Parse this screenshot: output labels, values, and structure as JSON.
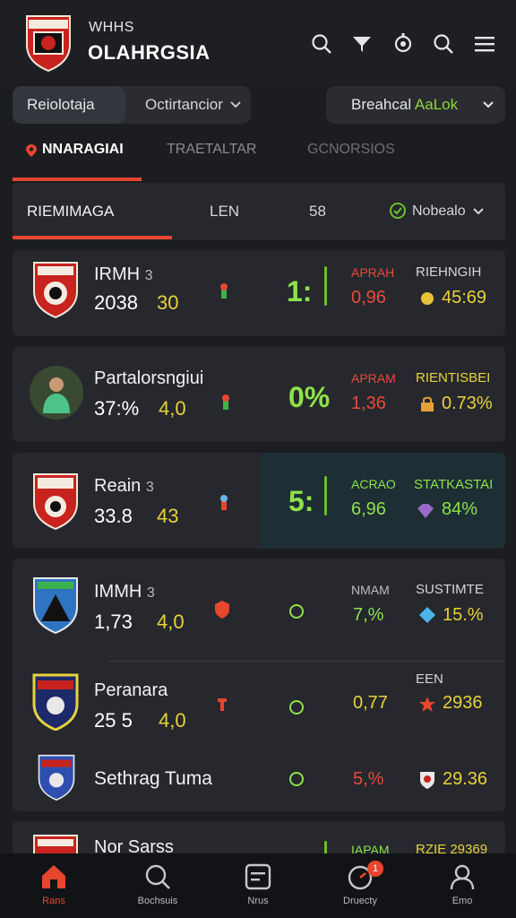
{
  "header": {
    "brand_top": "WHHS",
    "brand_main": "OLAHRGSIA",
    "icons": [
      "search-icon",
      "filter-icon",
      "settings-icon",
      "search-icon",
      "menu-icon"
    ]
  },
  "filters": {
    "left_selected": "Reiolotaja",
    "left_other": "Octirtancior",
    "right_label": "Breahcal",
    "right_accent": "AaLok"
  },
  "tabs": [
    {
      "label": "NNARAGIAI",
      "active": true
    },
    {
      "label": "TRAETALTAR",
      "active": false
    },
    {
      "label": "GCNORSIOS",
      "active": false
    }
  ],
  "panel": {
    "title": "RIEMIMAGA",
    "col2": "LEN",
    "col3": "58",
    "dropdown": "Nobealo"
  },
  "matches": [
    {
      "name": "IRMH",
      "badge": "3",
      "value": "2038",
      "sub": "30",
      "score": "1:",
      "label1": "APRAH",
      "odd": "0,96",
      "label2": "RIEHNGIH",
      "pct": "45:69"
    },
    {
      "name": "Partalorsngiui",
      "value": "37:%",
      "sub": "4,0",
      "score": "0%",
      "label1": "APRAM",
      "odd": "1,36",
      "label2": "RIENTISBEI",
      "pct": "0.73%"
    },
    {
      "name": "Reain",
      "badge": "3",
      "value": "33.8",
      "sub": "43",
      "score": "5:",
      "label1": "ACRAO",
      "odd": "6,96",
      "label2": "STATKASTAI",
      "pct": "84%"
    },
    {
      "name": "IMMH",
      "badge": "3",
      "value": "1,73",
      "sub": "4,0",
      "label1": "NMAM",
      "odd": "7,%",
      "label2": "SUSTIMTE",
      "pct": "15.%"
    },
    {
      "name": "Peranara",
      "value": "25 5",
      "sub": "4,0",
      "label2": "EEN",
      "odd": "0,77",
      "pct": "2936"
    },
    {
      "name": "Sethrag Tuma",
      "odd": "5,%",
      "pct": "29.36"
    },
    {
      "name": "Nor Sarss",
      "label1": "IAPAM",
      "label2": "RZIE 29369"
    }
  ],
  "bottom_nav": [
    {
      "label": "Rans",
      "icon": "home-icon",
      "active": true
    },
    {
      "label": "Bochsuis",
      "icon": "search-icon",
      "active": false
    },
    {
      "label": "Nrus",
      "icon": "list-icon",
      "active": false
    },
    {
      "label": "Druecty",
      "icon": "timer-icon",
      "active": false,
      "badge": "1"
    },
    {
      "label": "Emo",
      "icon": "user-icon",
      "active": false
    }
  ],
  "colors": {
    "accent": "#e8452e",
    "positive": "#8ee24a",
    "warning": "#e8d23a",
    "negative": "#ea4a3b",
    "background": "#1c1d21",
    "card": "#26282d"
  }
}
